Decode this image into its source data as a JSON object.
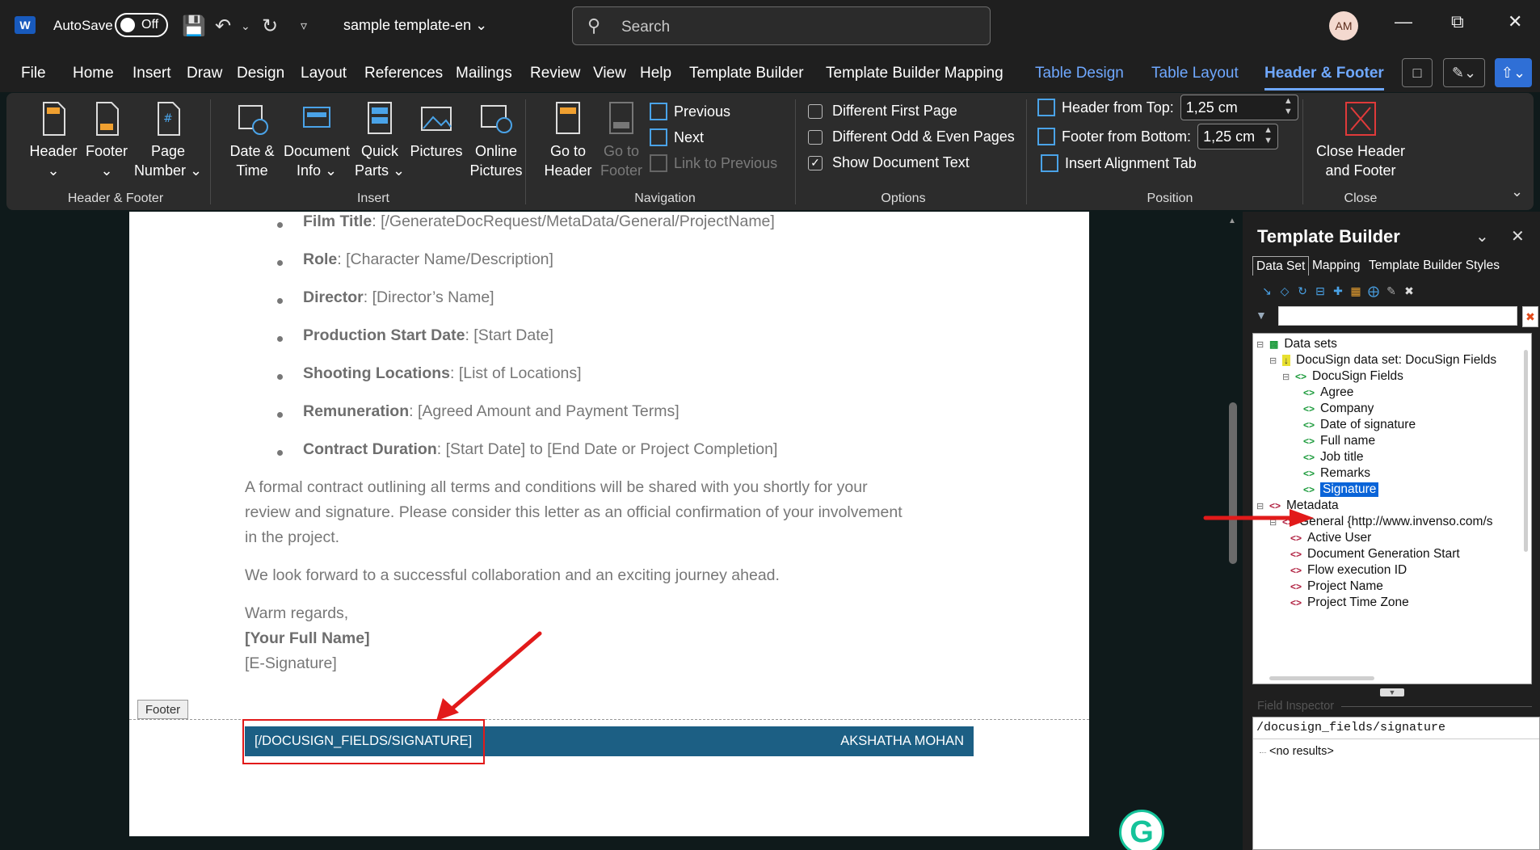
{
  "app": {
    "autosave_label": "AutoSave",
    "autosave_state": "Off",
    "doc_title": "sample template-en",
    "search_placeholder": "Search",
    "avatar_initials": "AM"
  },
  "tabs": [
    "File",
    "Home",
    "Insert",
    "Draw",
    "Design",
    "Layout",
    "References",
    "Mailings",
    "Review",
    "View",
    "Help",
    "Template Builder",
    "Template Builder Mapping",
    "Table Design",
    "Table Layout",
    "Header & Footer"
  ],
  "ribbon": {
    "header_footer": {
      "header": "Header",
      "footer": "Footer",
      "page_number": "Page Number",
      "group": "Header & Footer"
    },
    "insert": {
      "date_time": "Date & Time",
      "document_info": "Document Info",
      "quick_parts": "Quick Parts",
      "pictures": "Pictures",
      "online_pictures": "Online Pictures",
      "group": "Insert"
    },
    "navigation": {
      "go_to_header": "Go to Header",
      "go_to_footer": "Go to Footer",
      "previous": "Previous",
      "next": "Next",
      "link_to_previous": "Link to Previous",
      "group": "Navigation"
    },
    "options": {
      "different_first_page": "Different First Page",
      "different_odd_even": "Different Odd & Even Pages",
      "show_document_text": "Show Document Text",
      "show_document_text_checked": true,
      "group": "Options"
    },
    "position": {
      "header_from_top_label": "Header from Top:",
      "header_from_top": "1,25 cm",
      "footer_from_bottom_label": "Footer from Bottom:",
      "footer_from_bottom": "1,25 cm",
      "insert_alignment_tab": "Insert Alignment Tab",
      "group": "Position"
    },
    "close": {
      "close_header_footer": "Close Header and Footer",
      "group": "Close"
    }
  },
  "document": {
    "bullets": [
      {
        "label": "Film Title",
        "value": ": [/GenerateDocRequest/MetaData/General/ProjectName]"
      },
      {
        "label": "Role",
        "value": ": [Character Name/Description]"
      },
      {
        "label": "Director",
        "value": ": [Director’s Name]"
      },
      {
        "label": "Production Start Date",
        "value": ": [Start Date]"
      },
      {
        "label": "Shooting Locations",
        "value": ": [List of Locations]"
      },
      {
        "label": "Remuneration",
        "value": ": [Agreed Amount and Payment Terms]"
      },
      {
        "label": "Contract Duration",
        "value": ": [Start Date] to [End Date or Project Completion]"
      }
    ],
    "para1_line1": "A formal contract outlining all terms and conditions will be shared with you shortly for your",
    "para1_line2": "review and signature. Please consider this letter as an official confirmation of your involvement",
    "para1_line3": "in the project.",
    "para2": "We look forward to a successful collaboration and an exciting journey ahead.",
    "closing": "Warm regards,",
    "name_placeholder": "[Your Full Name]",
    "esig_placeholder": "[E-Signature]",
    "footer_tag": "Footer",
    "footer_left": "[/DOCUSIGN_FIELDS/SIGNATURE]",
    "footer_right": "AKSHATHA MOHAN"
  },
  "template_builder": {
    "title": "Template Builder",
    "tabs": [
      "Data Set",
      "Mapping",
      "Template Builder Styles"
    ],
    "tree": {
      "data_sets": "Data sets",
      "docusign_data_set": "DocuSign data set: DocuSign Fields",
      "docusign_fields": "DocuSign Fields",
      "fields": [
        "Agree",
        "Company",
        "Date of signature",
        "Full name",
        "Job title",
        "Remarks",
        "Signature"
      ],
      "metadata": "Metadata",
      "general": "General {http://www.invenso.com/s",
      "general_items": [
        "Active User",
        "Document Generation Start",
        "Flow execution ID",
        "Project Name",
        "Project Time Zone"
      ]
    },
    "field_inspector_label": "Field Inspector",
    "field_inspector_path": "/docusign_fields/signature",
    "field_inspector_result": "<no results>"
  },
  "colors": {
    "accent": "#6fa8ff",
    "footer_bar": "#1c5f84",
    "annotation_red": "#e21a1a",
    "selection": "#0a64d8"
  }
}
